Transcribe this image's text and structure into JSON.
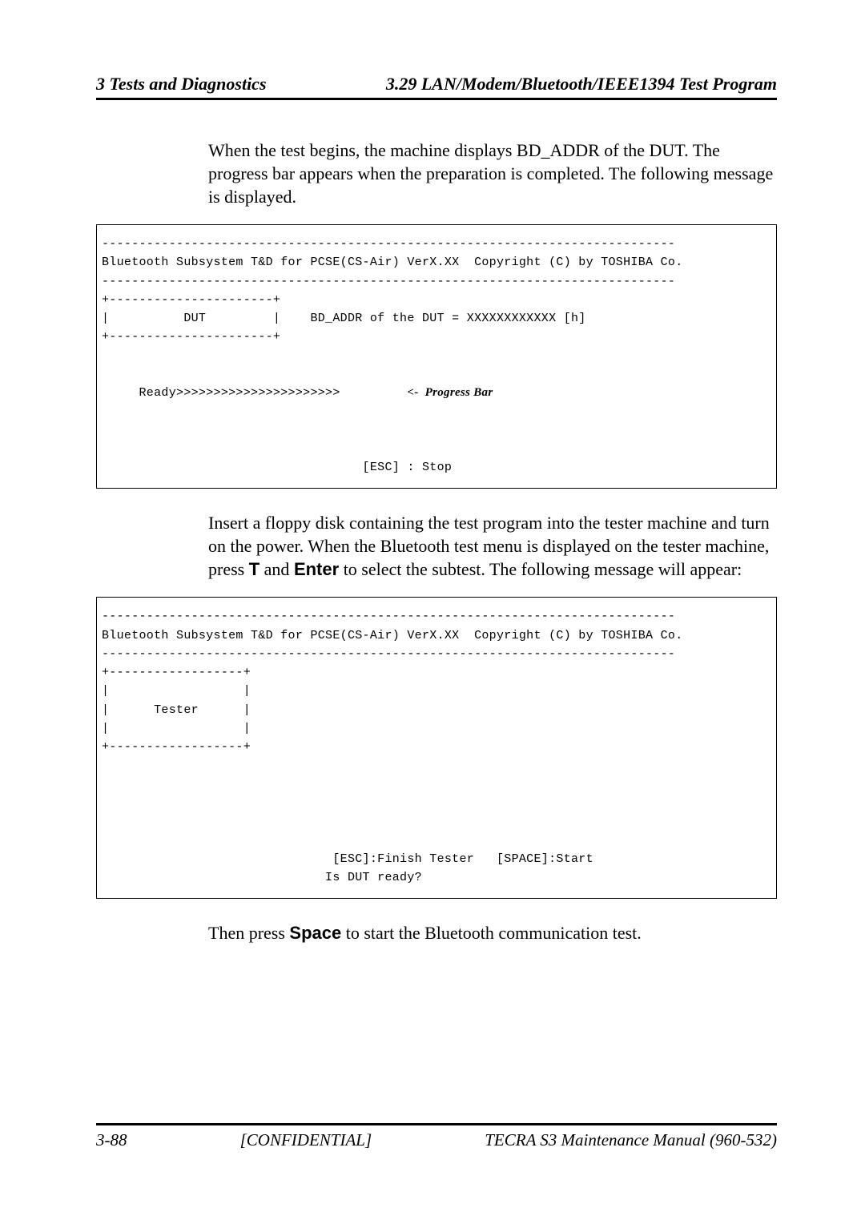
{
  "header": {
    "left": "3  Tests and Diagnostics",
    "right": "3.29 LAN/Modem/Bluetooth/IEEE1394 Test Program"
  },
  "para1": "When the test begins, the machine displays BD_ADDR of the DUT. The progress bar appears when the preparation is completed. The following message is displayed.",
  "console1": {
    "l1": "-----------------------------------------------------------------------------",
    "l2": "Bluetooth Subsystem T&D for PCSE(CS-Air) VerX.XX  Copyright (C) by TOSHIBA Co.",
    "l3": "-----------------------------------------------------------------------------",
    "l4": "+----------------------+",
    "l5": "|          DUT         |    BD_ADDR of the DUT = XXXXXXXXXXXX [h]",
    "l6": "+----------------------+",
    "l7a": "     Ready>>>>>>>>>>>>>>>>>>>>>>         ",
    "l7b": "<-  Progress Bar",
    "l8": "                                   [ESC] : Stop"
  },
  "para2a": "Insert a floppy disk containing the test program into the tester machine and turn on the power. When the Bluetooth test menu is displayed on the tester machine, press ",
  "key_t": "T",
  "para2b": " and ",
  "key_enter": "Enter",
  "para2c": " to select the subtest. The following message will appear:",
  "console2": {
    "l1": "-----------------------------------------------------------------------------",
    "l2": "Bluetooth Subsystem T&D for PCSE(CS-Air) VerX.XX  Copyright (C) by TOSHIBA Co.",
    "l3": "-----------------------------------------------------------------------------",
    "l4": "+------------------+",
    "l5": "|                  |",
    "l6": "|      Tester      |",
    "l7": "|                  |",
    "l8": "+------------------+",
    "l9": "                               [ESC]:Finish Tester   [SPACE]:Start",
    "l10": "                              Is DUT ready?"
  },
  "para3a": "Then press ",
  "key_space": "Space",
  "para3b": " to start the Bluetooth communication test.",
  "footer": {
    "page": "3-88",
    "conf": "[CONFIDENTIAL]",
    "manual": "TECRA S3 Maintenance Manual (960-532)"
  }
}
